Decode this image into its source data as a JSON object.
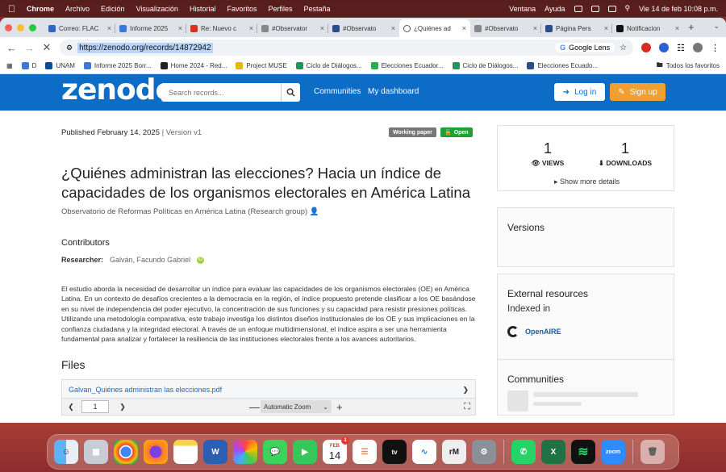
{
  "menubar": {
    "app": "Chrome",
    "items": [
      "Archivo",
      "Edición",
      "Visualización",
      "Historial",
      "Favoritos",
      "Perfiles",
      "Pestaña"
    ],
    "right_items": [
      "Ventana",
      "Ayuda"
    ],
    "datetime": "Vie 14 de feb  10:08 p.m."
  },
  "tabs": [
    {
      "label": "Correo: FLAC"
    },
    {
      "label": "Informe 2025"
    },
    {
      "label": "Re: Nuevo c"
    },
    {
      "label": "#Observator"
    },
    {
      "label": "#Observato"
    },
    {
      "label": "¿Quiénes ad"
    },
    {
      "label": "#Observato"
    },
    {
      "label": "Página Pers"
    },
    {
      "label": "Notificacion"
    }
  ],
  "active_tab_index": 5,
  "address": {
    "url": "https://zenodo.org/records/14872942",
    "lens_label": "Google Lens"
  },
  "bookmarks": [
    "D",
    "UNAM",
    "Informe 2025 Borr...",
    "Home 2024 - Red...",
    "Project MUSE",
    "Ciclo de Diálogos...",
    "Elecciones Ecuador...",
    "Ciclo de Diálogos...",
    "Elecciones Ecuado..."
  ],
  "bookmarks_folder": "Todos los favoritos",
  "zenodo": {
    "logo": "zenodo",
    "search_placeholder": "Search records...",
    "nav": [
      "Communities",
      "My dashboard"
    ],
    "login": "Log in",
    "signup": "Sign up"
  },
  "record": {
    "published": "Published February 14, 2025",
    "version": "| Version v1",
    "badge_type": "Working paper",
    "badge_access": "Open",
    "title": "¿Quiénes administran las elecciones? Hacia un índice de capacidades de los organismos electorales en América Latina",
    "org": "Observatorio de Reformas Políticas en América Latina (Research group)",
    "contributors_heading": "Contributors",
    "researcher_role": "Researcher:",
    "researcher_name": "Galván, Facundo Gabriel",
    "abstract": "El estudio aborda la necesidad de desarrollar un índice para evaluar las capacidades de los organismos electorales (OE) en América Latina. En un contexto de desafíos crecientes a la democracia en la región, el índice propuesto pretende clasificar a los OE basándose en su nivel de independencia del poder ejecutivo, la concentración de sus funciones y su capacidad para resistir presiones políticas. Utilizando una metodología comparativa, este trabajo investiga los distintos diseños institucionales de los OE y sus implicaciones en la confianza ciudadana y la integridad electoral. A través de un enfoque multidimensional, el índice aspira a ser una herramienta fundamental para analizar y fortalecer la resiliencia de las instituciones electorales frente a los avances autoritarios.",
    "files_heading": "Files",
    "file_name": "Galvan_Quiénes administran las elecciones.pdf",
    "viewer_page": "1",
    "viewer_zoom": "Automatic Zoom"
  },
  "sidebar": {
    "views_count": "1",
    "views_label": "VIEWS",
    "downloads_count": "1",
    "downloads_label": "DOWNLOADS",
    "show_more": "Show more details",
    "versions_title": "Versions",
    "external_title": "External resources",
    "indexed_in": "Indexed in",
    "openaire": "OpenAIRE",
    "communities_title": "Communities"
  },
  "dock": {
    "calendar_month": "FEB",
    "calendar_day": "14",
    "calendar_badge": "1",
    "apps": [
      "Finder",
      "Launchpad",
      "Chrome",
      "Firefox",
      "Notes",
      "Word",
      "Photos",
      "Messages",
      "FaceTime",
      "Calendar",
      "Reminders",
      "Apple TV",
      "Freeform",
      "rM",
      "System Settings",
      "WhatsApp",
      "Excel",
      "Spotify",
      "Zoom",
      "Trash"
    ]
  },
  "colors": {
    "zenodo_blue": "#0d6cc6",
    "signup_orange": "#f0a030",
    "open_green": "#21a038"
  }
}
